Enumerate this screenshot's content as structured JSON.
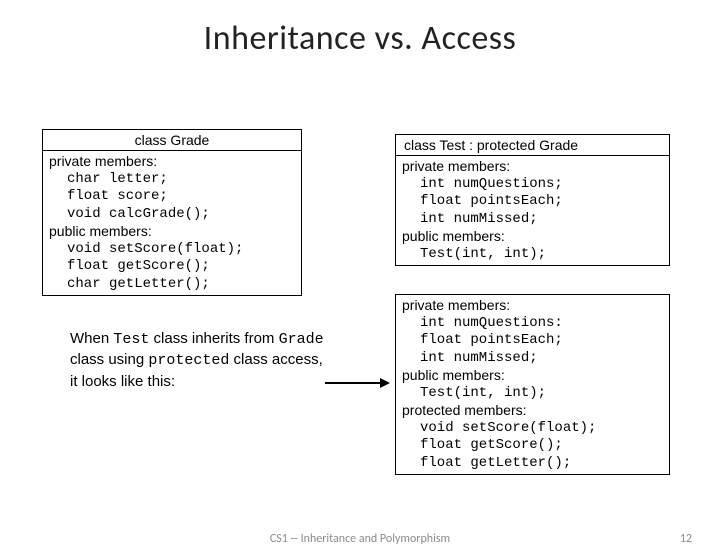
{
  "title": "Inheritance vs. Access",
  "grade": {
    "header": "class Grade",
    "priv_label": "private members:",
    "priv": [
      "char letter;",
      "float score;",
      "void calcGrade();"
    ],
    "pub_label": "public members:",
    "pub": [
      "void setScore(float);",
      "float getScore();",
      "char getLetter();"
    ]
  },
  "test": {
    "header": "class Test : protected Grade",
    "priv_label": "private members:",
    "priv": [
      "int numQuestions;",
      "float pointsEach;",
      "int numMissed;"
    ],
    "pub_label": "public members:",
    "pub": [
      "Test(int, int);"
    ]
  },
  "result": {
    "priv_label": "private members:",
    "priv": [
      "int numQuestions:",
      "float pointsEach;",
      "int numMissed;"
    ],
    "pub_label": "public members:",
    "pub": [
      "Test(int, int);"
    ],
    "prot_label": "protected members:",
    "prot": [
      "void setScore(float);",
      "float getScore();",
      "float getLetter();"
    ]
  },
  "caption": {
    "p1a": "When ",
    "p1b": "Test",
    "p1c": " class inherits from ",
    "p1d": "Grade",
    "p1e": " class using ",
    "p1f": "protected",
    "p1g": " class access, it looks like this:"
  },
  "footer": "CS1 -- Inheritance and Polymorphism",
  "page": "12"
}
